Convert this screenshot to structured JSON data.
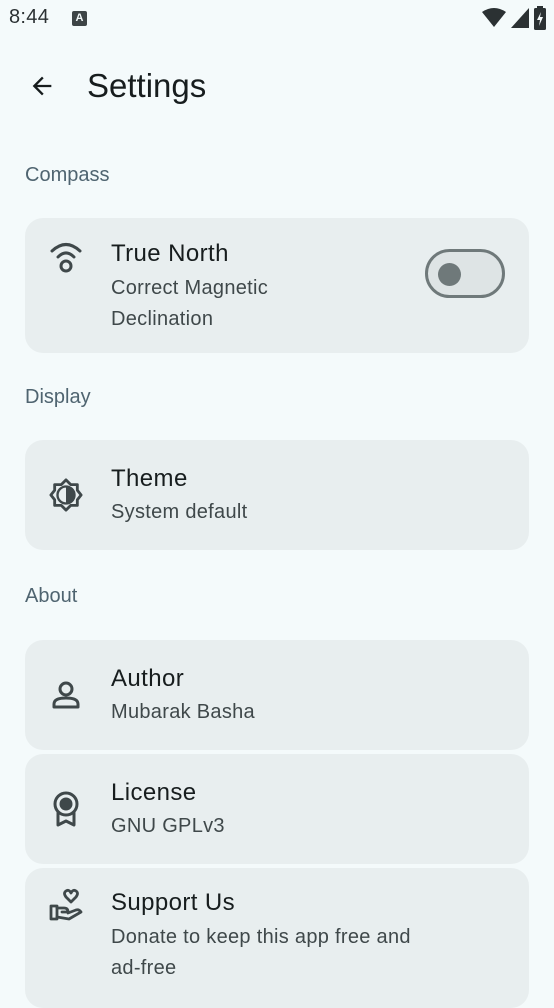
{
  "status_bar": {
    "time": "8:44",
    "notification_icon": "a-letter-icon",
    "notification_letter": "A",
    "wifi_icon": "wifi-icon",
    "signal_icon": "signal-icon",
    "battery_icon": "battery-icon"
  },
  "app_bar": {
    "back_icon": "arrow-back-icon",
    "title": "Settings"
  },
  "sections": {
    "compass": {
      "header": "Compass",
      "true_north": {
        "icon": "wireless-tower-icon",
        "title": "True North",
        "subtitle_line1": "Correct Magnetic",
        "subtitle_line2": "Declination",
        "toggle_on": false
      }
    },
    "display": {
      "header": "Display",
      "theme": {
        "icon": "brightness-icon",
        "title": "Theme",
        "subtitle": "System default"
      }
    },
    "about": {
      "header": "About",
      "author": {
        "icon": "person-icon",
        "title": "Author",
        "subtitle": "Mubarak Basha"
      },
      "license": {
        "icon": "license-badge-icon",
        "title": "License",
        "subtitle": "GNU GPLv3"
      },
      "support": {
        "icon": "volunteer-heart-icon",
        "title": "Support Us",
        "subtitle_line1": "Donate to keep this app free and",
        "subtitle_line2": "ad-free"
      }
    }
  },
  "colors": {
    "background": "#f4fafb",
    "card": "#e8eeef",
    "section_header": "#4f6470",
    "text_primary": "#171d1e",
    "text_secondary": "#3f484a",
    "toggle_outline": "#6f797a"
  }
}
